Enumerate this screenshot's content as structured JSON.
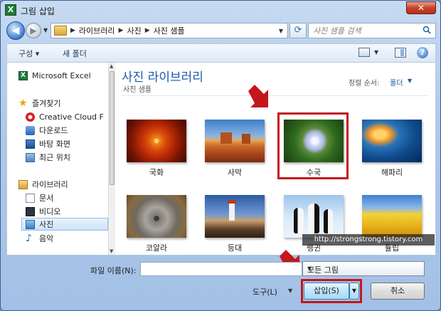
{
  "window": {
    "title": "그림 삽입",
    "close_glyph": "✕",
    "app_icon_letter": "X"
  },
  "address_bar": {
    "breadcrumbs": [
      "라이브러리",
      "사진",
      "사진 샘플"
    ],
    "search_placeholder": "사진 샘플 검색"
  },
  "toolbar": {
    "organize_label": "구성 ▾",
    "new_folder_label": "새 폴더",
    "help_label": "?"
  },
  "nav_pane": {
    "items": [
      {
        "label": "Microsoft Excel",
        "icon": "excel-icon"
      },
      {
        "label": "즐겨찾기",
        "icon": "star-icon"
      },
      {
        "label": "Creative Cloud F",
        "icon": "creative-cloud-icon"
      },
      {
        "label": "다운로드",
        "icon": "download-icon"
      },
      {
        "label": "바탕 화면",
        "icon": "desktop-icon"
      },
      {
        "label": "최근 위치",
        "icon": "recent-icon"
      },
      {
        "label": "라이브러리",
        "icon": "library-icon"
      },
      {
        "label": "문서",
        "icon": "document-icon"
      },
      {
        "label": "비디오",
        "icon": "video-icon"
      },
      {
        "label": "사진",
        "icon": "picture-icon",
        "selected": true
      },
      {
        "label": "음악",
        "icon": "music-icon"
      }
    ]
  },
  "library": {
    "title": "사진 라이브러리",
    "subtitle": "사진 샘플",
    "sort_label": "정렬 순서:",
    "sort_value": "폴더"
  },
  "thumbnails": [
    {
      "caption": "국화"
    },
    {
      "caption": "사막"
    },
    {
      "caption": "수국",
      "highlighted": true
    },
    {
      "caption": "해파리"
    },
    {
      "caption": "코알라"
    },
    {
      "caption": "등대"
    },
    {
      "caption": "펭귄"
    },
    {
      "caption": "튤립"
    }
  ],
  "bottom": {
    "filename_label": "파일 이름(N):",
    "filename_value": "",
    "filetype_value": "모든 그림",
    "tools_label": "도구(L)",
    "insert_label": "삽입(S)",
    "cancel_label": "취소"
  },
  "watermark": "http://strongstrong.tistory.com",
  "colors": {
    "accent_title": "#1e5aa8",
    "highlight_red": "#c4161c"
  }
}
